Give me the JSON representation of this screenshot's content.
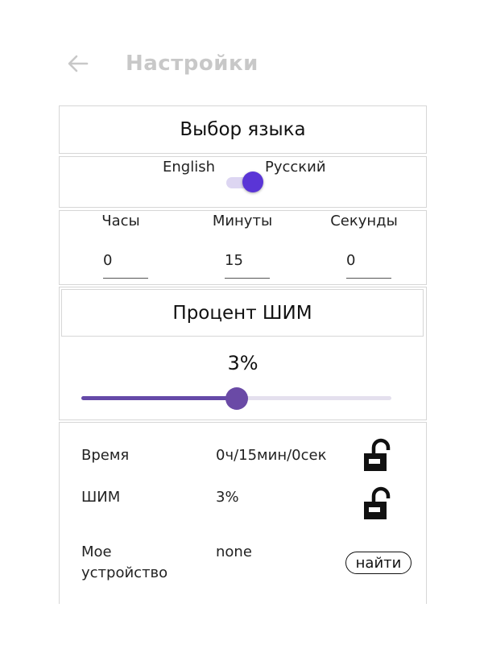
{
  "header": {
    "title": "Настройки",
    "back_icon": "arrow-left-icon"
  },
  "language": {
    "header": "Выбор языка",
    "option_left": "English",
    "option_right": "Русский",
    "selected": "Русский",
    "accent_color": "#5a35d6"
  },
  "time": {
    "fields": [
      {
        "label": "Часы",
        "value": "0"
      },
      {
        "label": "Минуты",
        "value": "15"
      },
      {
        "label": "Секунды",
        "value": "0"
      }
    ]
  },
  "pwm": {
    "header": "Процент ШИМ",
    "value_text": "3%",
    "slider_fraction": 0.5,
    "slider_color": "#6a4aa6"
  },
  "status": {
    "rows": [
      {
        "label": "Время",
        "value": "0ч/15мин/0сек",
        "icon": "lock-open-icon"
      },
      {
        "label": "ШИМ",
        "value": "3%",
        "icon": "lock-open-icon"
      }
    ],
    "device": {
      "label": "Мое устройство",
      "value": "none",
      "button_label": "найти"
    }
  }
}
